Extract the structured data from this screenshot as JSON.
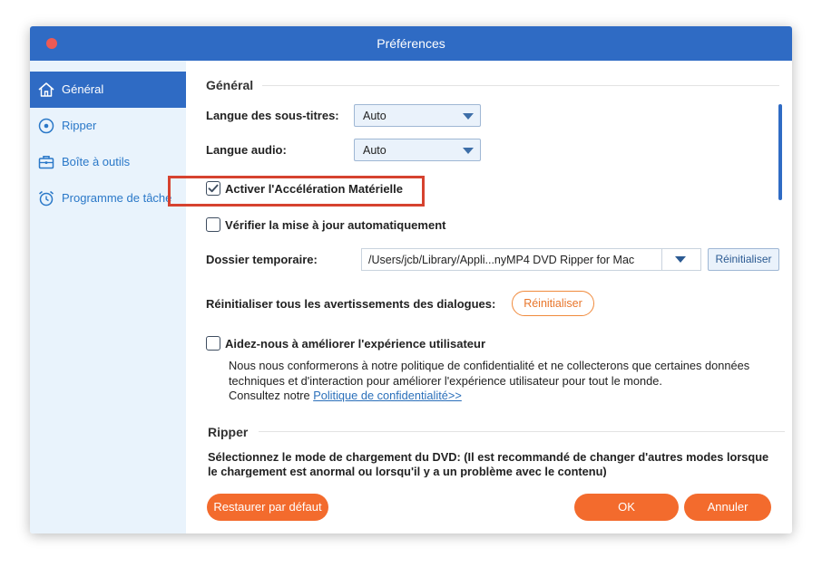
{
  "window": {
    "title": "Préférences"
  },
  "sidebar": {
    "items": [
      {
        "label": "Général",
        "icon": "home-icon",
        "active": true
      },
      {
        "label": "Ripper",
        "icon": "disc-icon",
        "active": false
      },
      {
        "label": "Boîte à outils",
        "icon": "toolbox-icon",
        "active": false
      },
      {
        "label": "Programme de tâche",
        "icon": "alarm-clock-icon",
        "active": false
      }
    ]
  },
  "general": {
    "section_title": "Général",
    "subtitle_lang_label": "Langue des sous-titres:",
    "subtitle_lang_value": "Auto",
    "audio_lang_label": "Langue audio:",
    "audio_lang_value": "Auto",
    "hw_accel_label": "Activer l'Accélération Matérielle",
    "hw_accel_checked": true,
    "auto_update_label": "Vérifier la mise à jour automatiquement",
    "auto_update_checked": false,
    "temp_folder_label": "Dossier temporaire:",
    "temp_folder_value": "/Users/jcb/Library/Appli...nyMP4 DVD Ripper for Mac",
    "temp_folder_reset": "Réinitialiser",
    "reset_warnings_label": "Réinitialiser tous les avertissements des dialogues:",
    "reset_warnings_button": "Réinitialiser",
    "improve_label": "Aidez-nous à améliorer l'expérience utilisateur",
    "improve_checked": false,
    "improve_desc": "Nous nous conformerons à notre politique de confidentialité et ne collecterons que certaines données techniques et d'interaction pour améliorer l'expérience utilisateur pour tout le monde.",
    "improve_consult": "Consultez notre ",
    "privacy_link": "Politique de confidentialité>>"
  },
  "ripper": {
    "section_title": "Ripper",
    "dvd_mode_text": "Sélectionnez le mode de chargement du DVD: (Il est recommandé de changer d'autres modes lorsque le chargement est anormal ou lorsqu'il y a un problème avec le contenu)"
  },
  "footer": {
    "restore_label": "Restaurer par défaut",
    "ok_label": "OK",
    "cancel_label": "Annuler"
  },
  "colors": {
    "title_bar": "#2f6bc4",
    "accent_orange": "#f36b2d",
    "highlight_red": "#d6422f",
    "sidebar_bg": "#e9f3fc"
  }
}
